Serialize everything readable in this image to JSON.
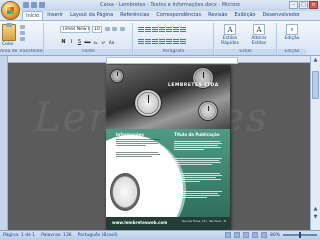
{
  "window": {
    "title": "Caixa - Lembretes - Textos e Informações.docx - Microsoft Word",
    "controls": [
      "–",
      "□",
      "×"
    ]
  },
  "tabs": [
    "Início",
    "Inserir",
    "Layout da Página",
    "Referências",
    "Correspondências",
    "Revisão",
    "Exibição",
    "Desenvolvedor"
  ],
  "ribbon": {
    "paste_label": "Colar",
    "groups": {
      "clipboard": "Área de Transferência",
      "font": "Fonte",
      "paragraph": "Parágrafo",
      "styles": "Estilo",
      "editing": "Edição"
    },
    "font_name": "Times New Ro",
    "font_size": "10",
    "format_buttons": [
      "N",
      "I",
      "S",
      "abc",
      "x₂",
      "x²",
      "Aa"
    ],
    "quick_styles_label": "Estilos Rápidos",
    "change_styles_label": "Alterar Estilos",
    "editing_label": "Edição"
  },
  "document": {
    "hero_title": "LEMBRETES LTDA",
    "col_left_title": "Informações",
    "col_right_title": "Título da Publicação",
    "url": "www.lembretesweb.com",
    "footer_text": "Rua das Flores, 123 - São Paulo - SP - Brasil - CEP 00000-000"
  },
  "status": {
    "page": "Página: 1 de 1",
    "words": "Palavras: 136",
    "language": "Português (Brasil)",
    "zoom": "80%"
  }
}
